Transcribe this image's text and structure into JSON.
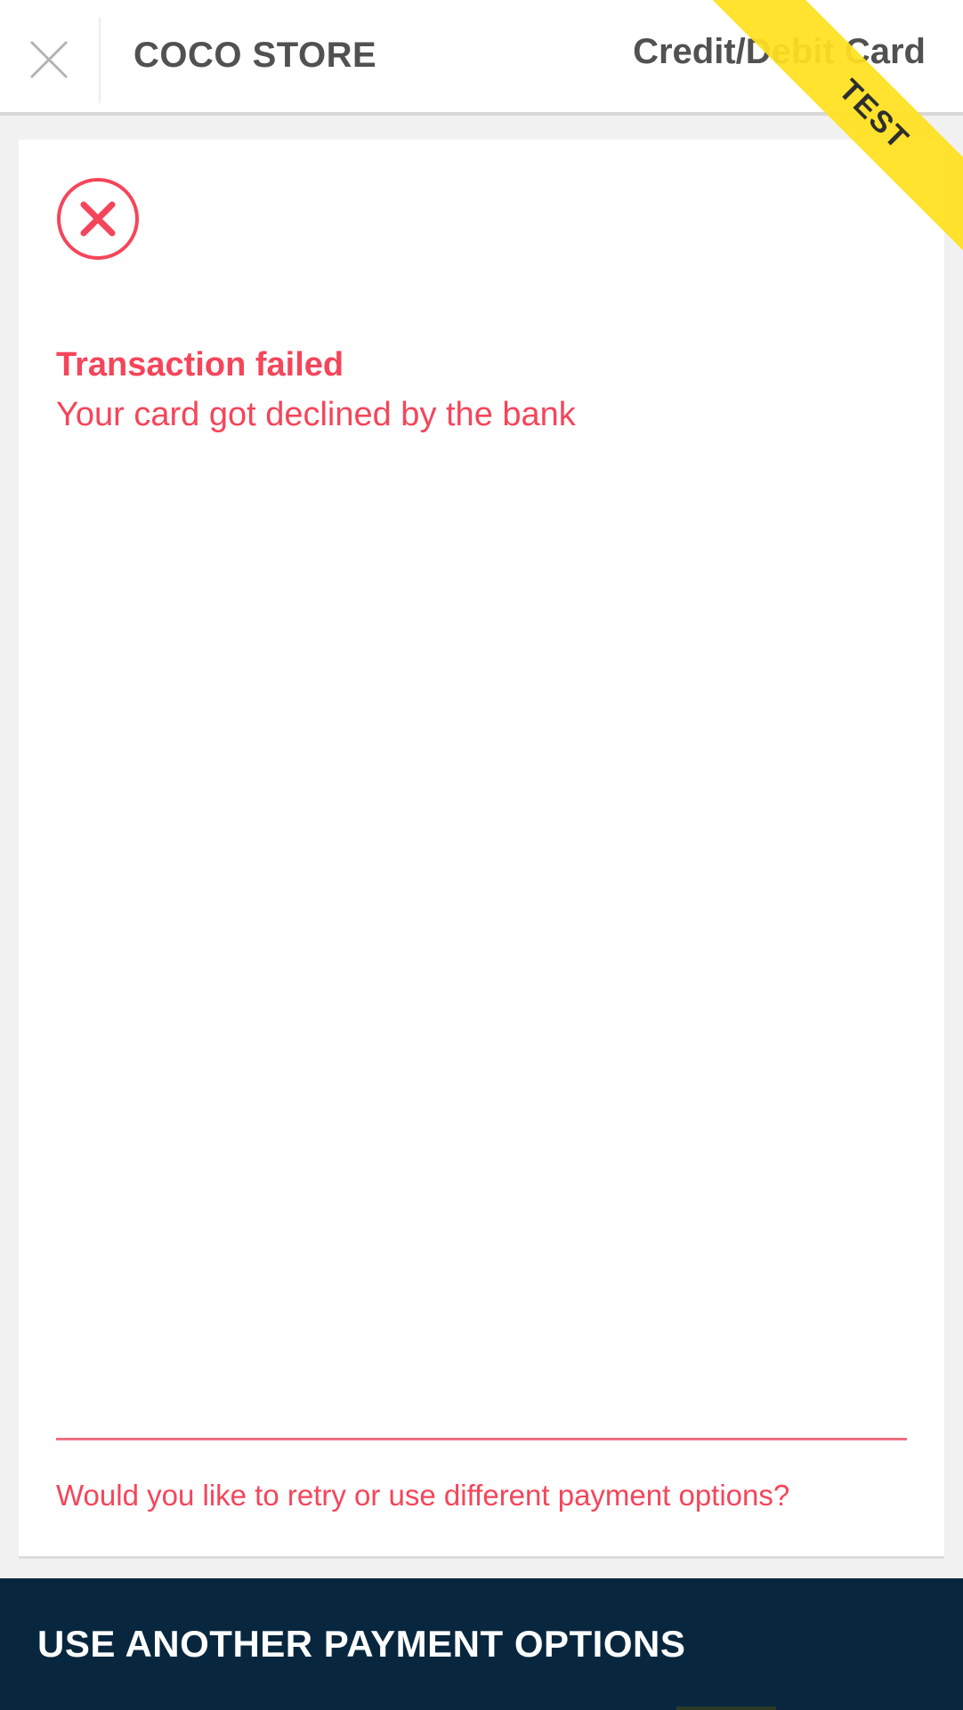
{
  "header": {
    "close_icon": "close-icon",
    "store_name": "COCO STORE",
    "payment_method": "Credit/Debit Card"
  },
  "ribbon": {
    "label": "TEST",
    "color": "#ffe11e"
  },
  "status": {
    "icon": "error-circle-x-icon",
    "title": "Transaction failed",
    "message": "Your card got declined by the bank",
    "color": "#f5455a"
  },
  "retry": {
    "prompt": "Would you like to retry or use different payment options?"
  },
  "action": {
    "label": "USE ANOTHER PAYMENT OPTIONS",
    "background": "#08273f"
  }
}
